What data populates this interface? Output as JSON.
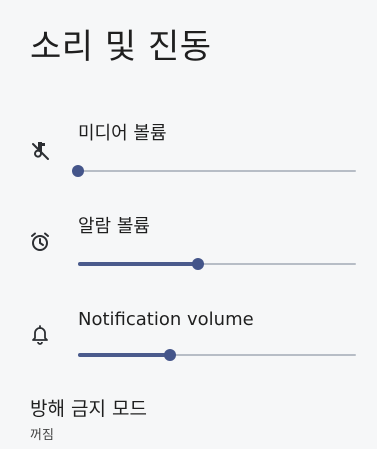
{
  "page": {
    "title": "소리 및 진동"
  },
  "volumes": [
    {
      "label": "미디어 볼륨",
      "icon": "music-off-icon",
      "level": 0.0
    },
    {
      "label": "알람 볼륨",
      "icon": "alarm-clock-icon",
      "level": 0.43
    },
    {
      "label": "Notification volume",
      "icon": "bell-icon",
      "level": 0.33
    }
  ],
  "do_not_disturb": {
    "title": "방해 금지 모드",
    "status": "꺼짐"
  },
  "colors": {
    "accent": "#44558a",
    "track_inactive": "#b7bdc6",
    "background": "#f6f7f8"
  }
}
